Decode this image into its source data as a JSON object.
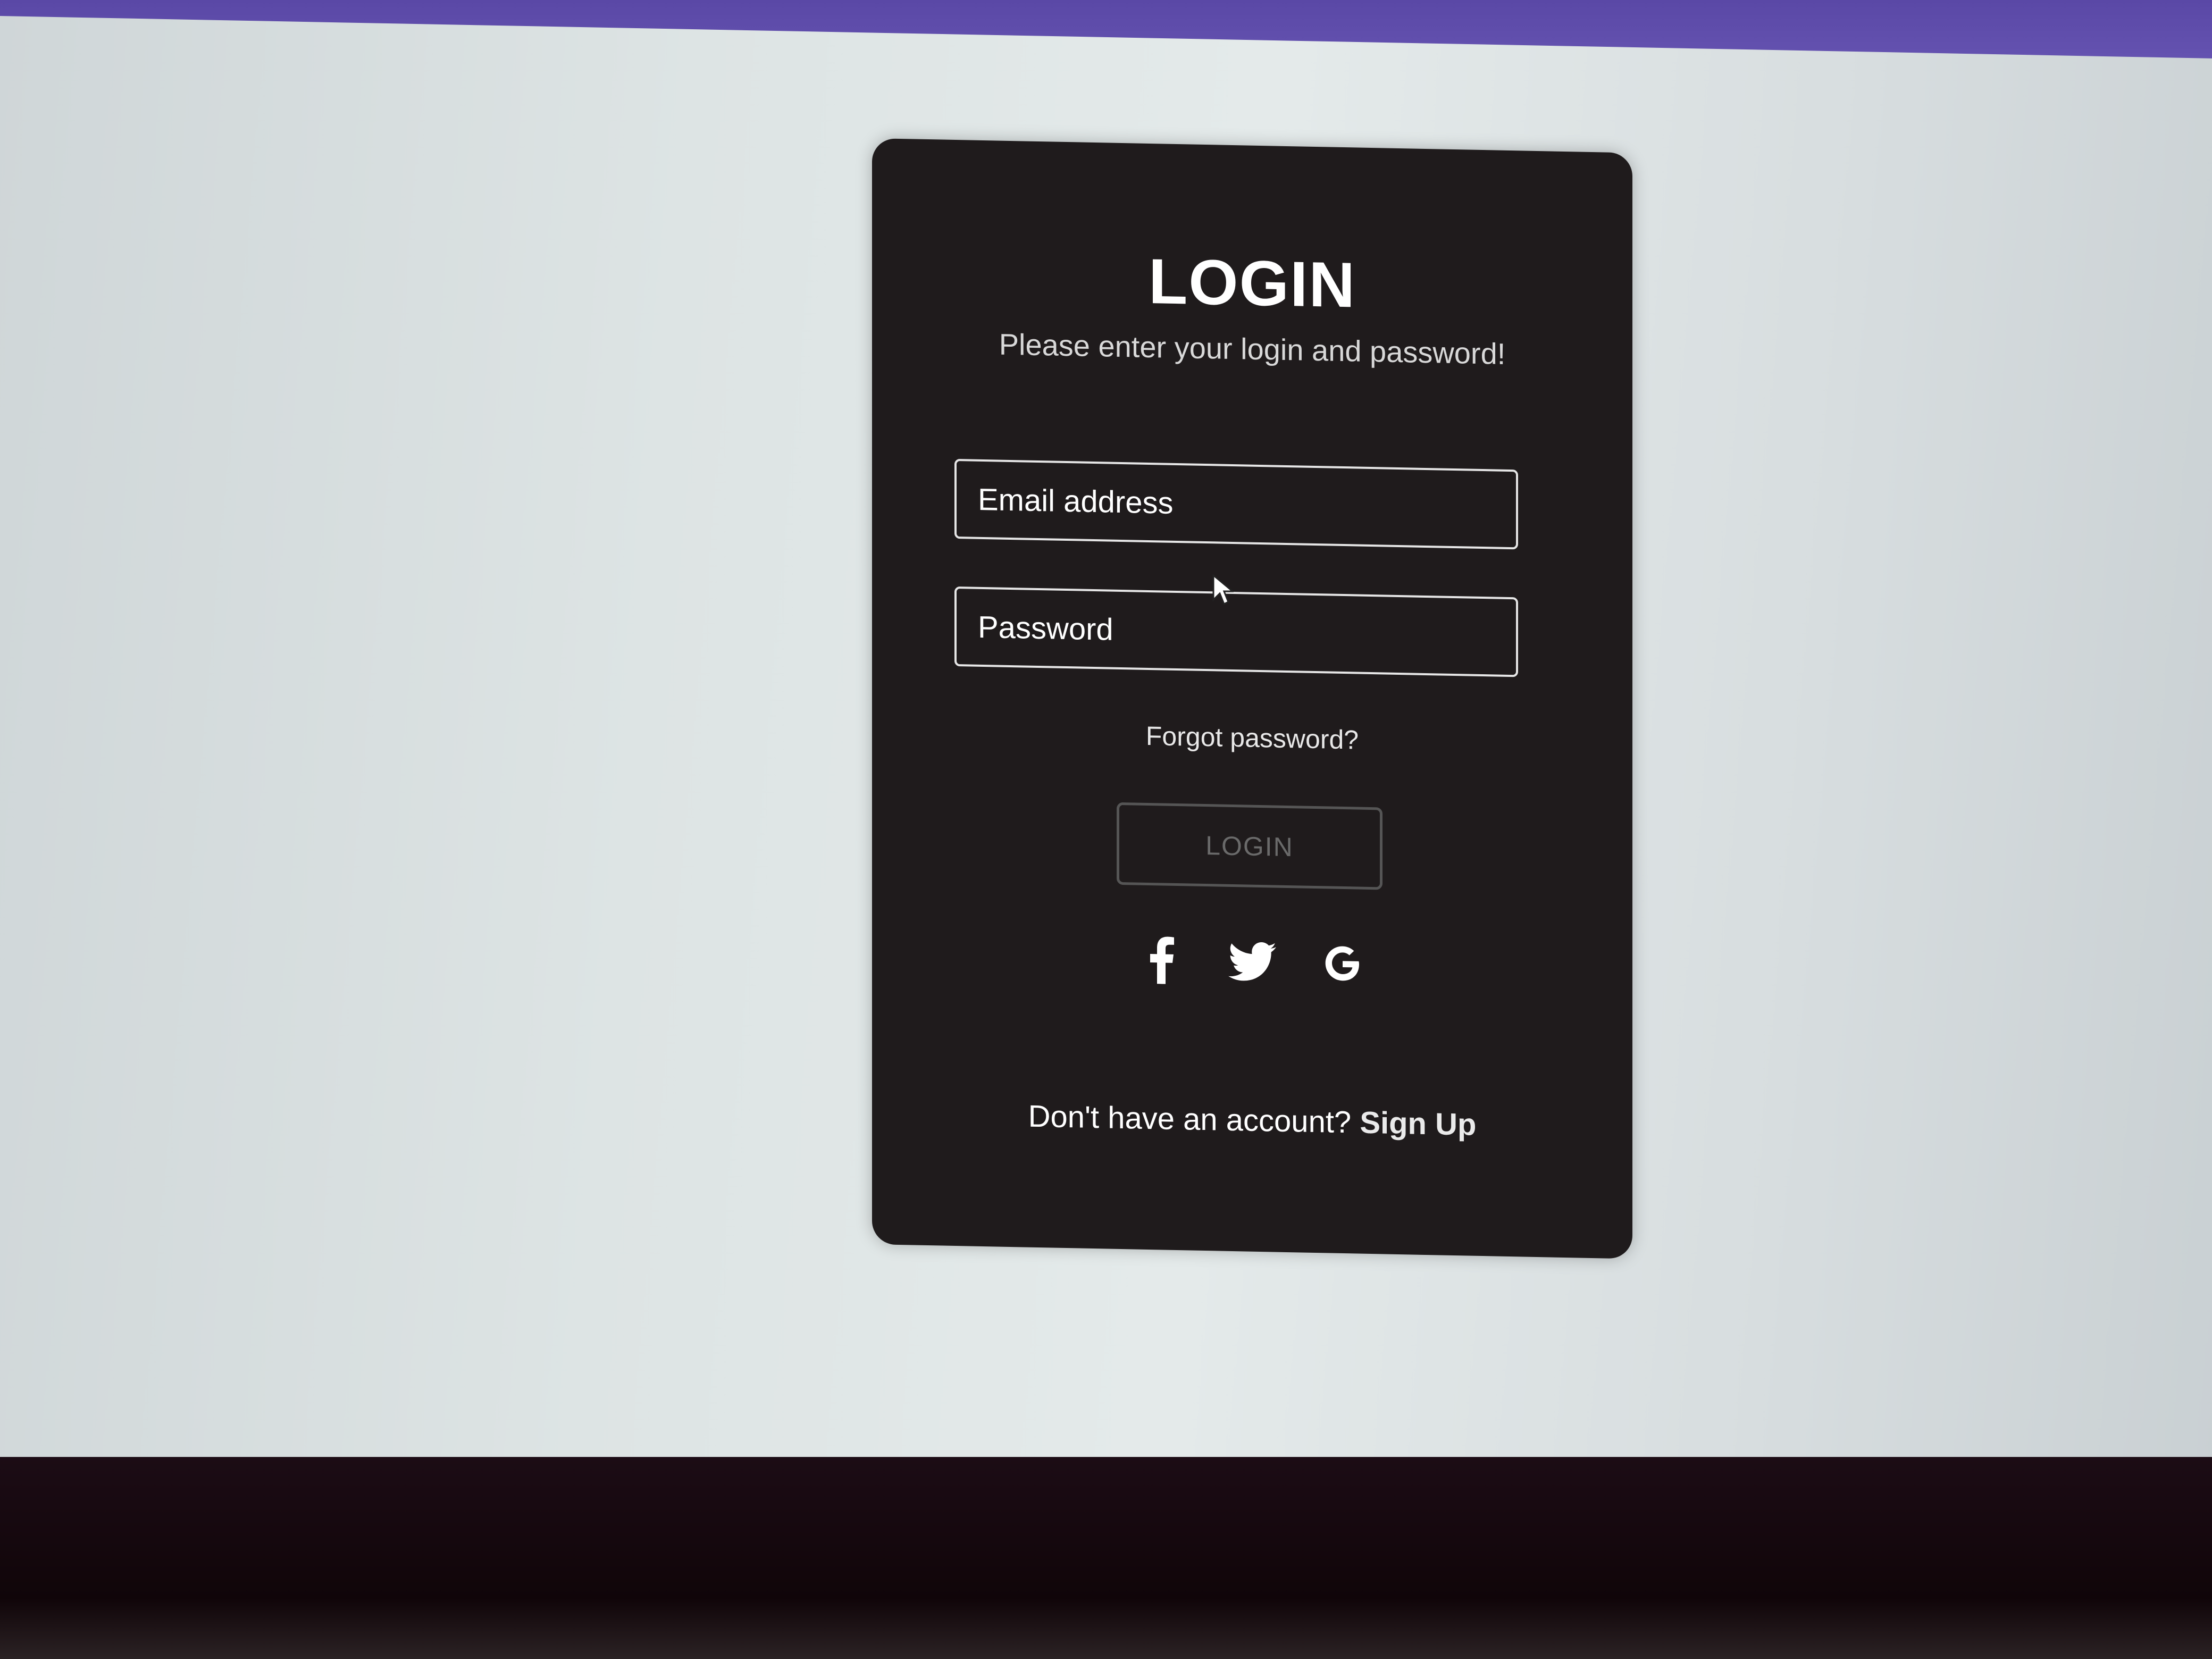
{
  "login_card": {
    "title": "LOGIN",
    "subtitle": "Please enter your login and password!",
    "email_placeholder": "Email address",
    "password_placeholder": "Password",
    "forgot_password": "Forgot password?",
    "login_button": "LOGIN",
    "social_icons": [
      "facebook-icon",
      "twitter-icon",
      "google-icon"
    ],
    "signup_prompt": "Don't have an account?",
    "signup_link": "Sign Up"
  },
  "colors": {
    "card_background": "#1f1b1c",
    "page_background": "#dde4e4",
    "text": "#ffffff",
    "button_border": "#555555",
    "button_text": "#6a6a6a"
  }
}
